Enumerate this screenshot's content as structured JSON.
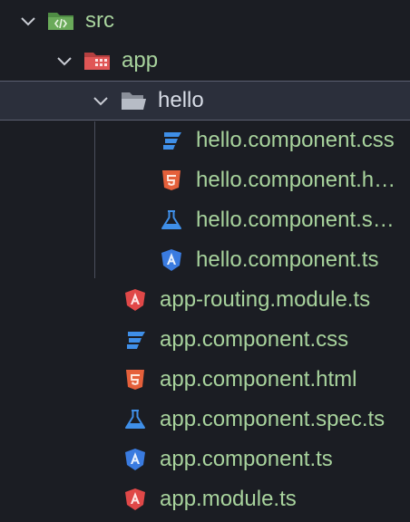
{
  "explorer": {
    "folders": {
      "src": {
        "label": "src",
        "icon": "source-folder-icon",
        "expanded": true
      },
      "app": {
        "label": "app",
        "icon": "app-folder-icon",
        "expanded": true
      },
      "hello": {
        "label": "hello",
        "icon": "folder-open-icon",
        "expanded": true,
        "selected": true
      }
    },
    "hello_files": [
      {
        "label": "hello.component.css",
        "icon": "css-file-icon"
      },
      {
        "label": "hello.component.html",
        "icon": "html-file-icon"
      },
      {
        "label": "hello.component.spec.ts",
        "icon": "spec-test-icon"
      },
      {
        "label": "hello.component.ts",
        "icon": "angular-component-icon"
      }
    ],
    "app_files": [
      {
        "label": "app-routing.module.ts",
        "icon": "angular-module-icon"
      },
      {
        "label": "app.component.css",
        "icon": "css-file-icon"
      },
      {
        "label": "app.component.html",
        "icon": "html-file-icon"
      },
      {
        "label": "app.component.spec.ts",
        "icon": "spec-test-icon"
      },
      {
        "label": "app.component.ts",
        "icon": "angular-component-icon"
      },
      {
        "label": "app.module.ts",
        "icon": "angular-module-icon"
      }
    ],
    "colors": {
      "background": "#1b1d23",
      "selected_row": "#2b2f3b",
      "file_text": "#a8d39d",
      "selected_text": "#d7dce6",
      "css_blue": "#3f8fe8",
      "html_orange": "#e5603b",
      "angular_red": "#e04848",
      "angular_blue": "#3a7be0",
      "folder_green": "#5c9f4e"
    }
  }
}
